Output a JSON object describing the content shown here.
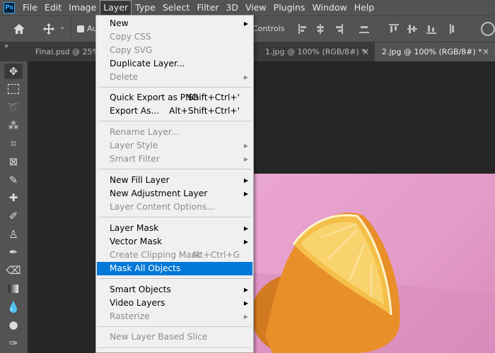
{
  "menubar": {
    "logo": "Ps",
    "items": [
      "File",
      "Edit",
      "Image",
      "Layer",
      "Type",
      "Select",
      "Filter",
      "3D",
      "View",
      "Plugins",
      "Window",
      "Help"
    ]
  },
  "options": {
    "auto_label": "Au",
    "controls_label": "Controls"
  },
  "tabs": [
    {
      "label": "Final.psd @ 25%"
    },
    {
      "label": "1.jpg @ 100% (RGB/8#) *"
    },
    {
      "label": "2.jpg @ 100% (RGB/8#) *"
    }
  ],
  "menu": {
    "items": {
      "new": {
        "label": "New"
      },
      "copy_css": {
        "label": "Copy CSS"
      },
      "copy_svg": {
        "label": "Copy SVG"
      },
      "duplicate": {
        "label": "Duplicate Layer..."
      },
      "delete": {
        "label": "Delete"
      },
      "quick_export": {
        "label": "Quick Export as PNG",
        "shortcut": "Shift+Ctrl+'"
      },
      "export_as": {
        "label": "Export As...",
        "shortcut": "Alt+Shift+Ctrl+'"
      },
      "rename": {
        "label": "Rename Layer..."
      },
      "layer_style": {
        "label": "Layer Style"
      },
      "smart_filter": {
        "label": "Smart Filter"
      },
      "new_fill": {
        "label": "New Fill Layer"
      },
      "new_adjustment": {
        "label": "New Adjustment Layer"
      },
      "content_options": {
        "label": "Layer Content Options..."
      },
      "layer_mask": {
        "label": "Layer Mask"
      },
      "vector_mask": {
        "label": "Vector Mask"
      },
      "clipping_mask": {
        "label": "Create Clipping Mask",
        "shortcut": "Alt+Ctrl+G"
      },
      "mask_all": {
        "label": "Mask All Objects"
      },
      "smart_objects": {
        "label": "Smart Objects"
      },
      "video_layers": {
        "label": "Video Layers"
      },
      "rasterize": {
        "label": "Rasterize"
      },
      "slice": {
        "label": "New Layer Based Slice"
      }
    }
  },
  "colors": {
    "highlight": "#0078d7",
    "menubar": "#535353",
    "canvas": "#262626",
    "photo_bg": "#e9a6d0"
  }
}
